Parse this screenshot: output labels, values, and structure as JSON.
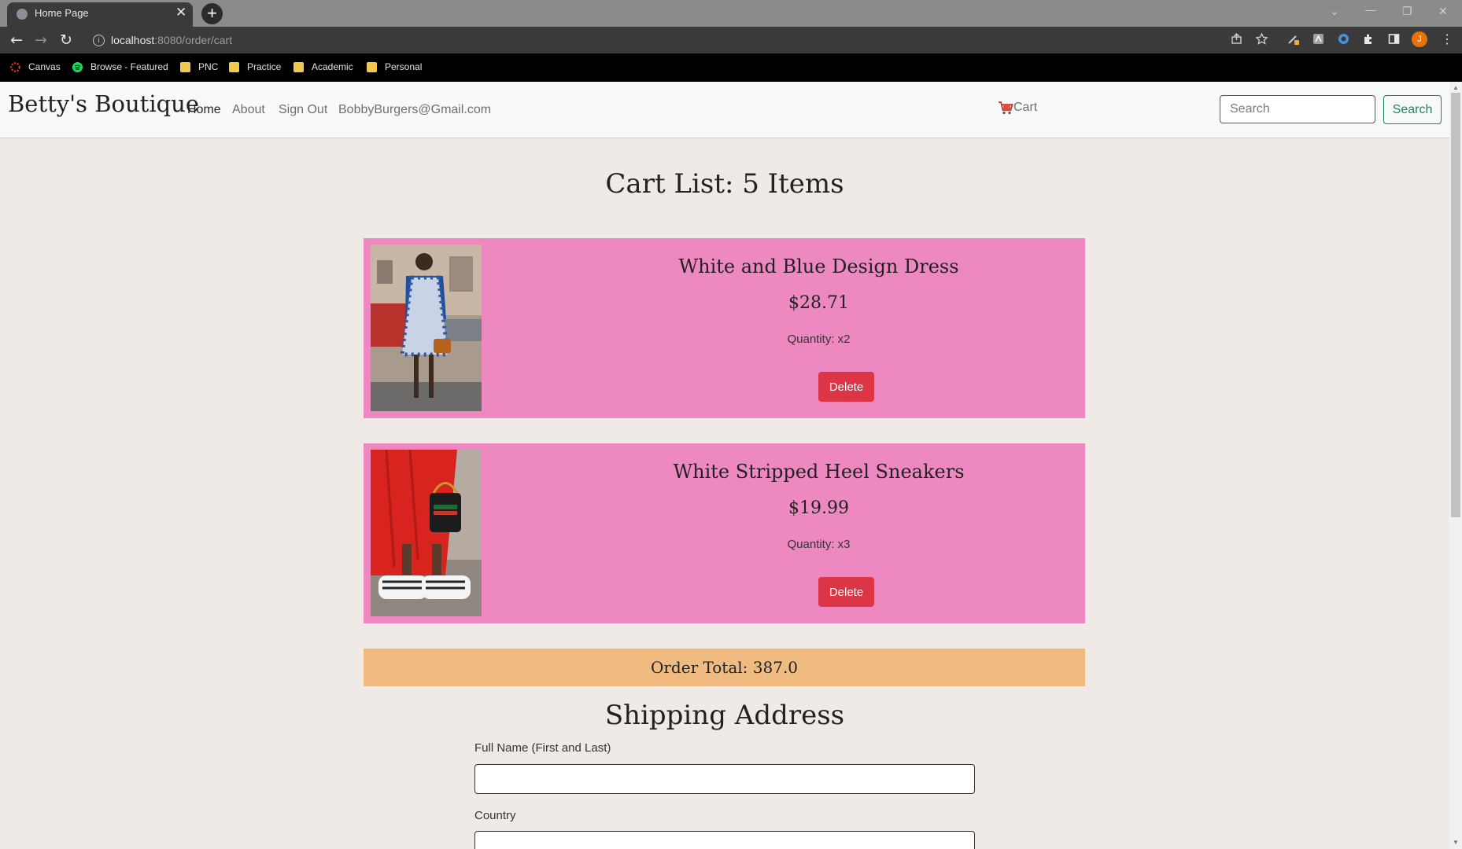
{
  "browser": {
    "tab_title": "Home Page",
    "tab_close": "✕",
    "new_tab": "+",
    "url_host": "localhost",
    "url_rest": ":8080/order/cart",
    "bookmarks": [
      {
        "label": "Canvas",
        "icon": "canvas-icon"
      },
      {
        "label": "Browse - Featured",
        "icon": "spotify-icon"
      },
      {
        "label": "PNC",
        "icon": "folder-icon"
      },
      {
        "label": "Practice",
        "icon": "folder-icon"
      },
      {
        "label": "Academic",
        "icon": "folder-icon"
      },
      {
        "label": "Personal",
        "icon": "folder-icon"
      }
    ],
    "profile_initial": "J"
  },
  "navbar": {
    "brand": "Betty's Boutique",
    "links": [
      "Home",
      "About",
      "Sign Out",
      "BobbyBurgers@Gmail.com"
    ],
    "cart_label": "Cart",
    "search_placeholder": "Search",
    "search_button": "Search"
  },
  "cart": {
    "title": "Cart List: 5 Items",
    "items": [
      {
        "name": "White and Blue Design Dress",
        "price": "$28.71",
        "quantity": "Quantity: x2",
        "delete_label": "Delete"
      },
      {
        "name": "White Stripped Heel Sneakers",
        "price": "$19.99",
        "quantity": "Quantity: x3",
        "delete_label": "Delete"
      }
    ],
    "order_total": "Order Total: 387.0"
  },
  "shipping": {
    "title": "Shipping Address",
    "fields": [
      {
        "label": "Full Name (First and Last)",
        "value": ""
      },
      {
        "label": "Country",
        "value": ""
      }
    ]
  },
  "colors": {
    "page_bg": "#efeae6",
    "card_bg": "#ee88c0",
    "total_bg": "#f0bb80",
    "delete_btn": "#dc3545",
    "search_btn": "#198754"
  }
}
